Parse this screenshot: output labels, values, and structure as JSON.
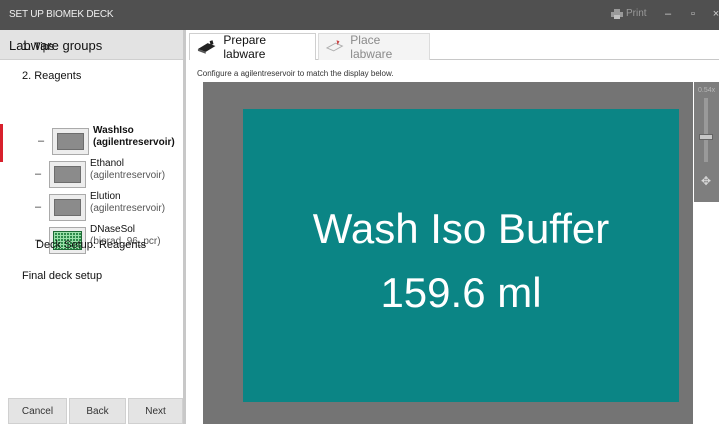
{
  "window": {
    "title": "SET UP BIOMEK DECK",
    "print_label": "Print",
    "minimize": "–",
    "maximize": "▫",
    "close": "×"
  },
  "sidebar": {
    "header": "Labware groups",
    "tips": "1. Tips",
    "reagents": "2. Reagents",
    "items": [
      {
        "name": "WashIso",
        "sub": "(agilentreservoir)",
        "icon": "reservoir-icon"
      },
      {
        "name": "Ethanol",
        "sub": "(agilentreservoir)",
        "icon": "reservoir-icon"
      },
      {
        "name": "Elution",
        "sub": "(agilentreservoir)",
        "icon": "reservoir-icon"
      },
      {
        "name": "DNaseSol",
        "sub": "(biorad_96_pcr)",
        "icon": "plate-96-icon"
      }
    ],
    "dash": "–",
    "deck_setup": "Deck Setup: Reagents",
    "final": "Final deck setup"
  },
  "buttons": {
    "cancel": "Cancel",
    "back": "Back",
    "next": "Next"
  },
  "tabs": {
    "prepare": "Prepare labware",
    "place": "Place labware"
  },
  "instruction": "Configure a agilentreservoir to match the display below.",
  "display": {
    "line1": "Wash Iso Buffer",
    "line2": "159.6 ml",
    "color": "#0b8585"
  },
  "zoom": {
    "label": "0.54x"
  }
}
